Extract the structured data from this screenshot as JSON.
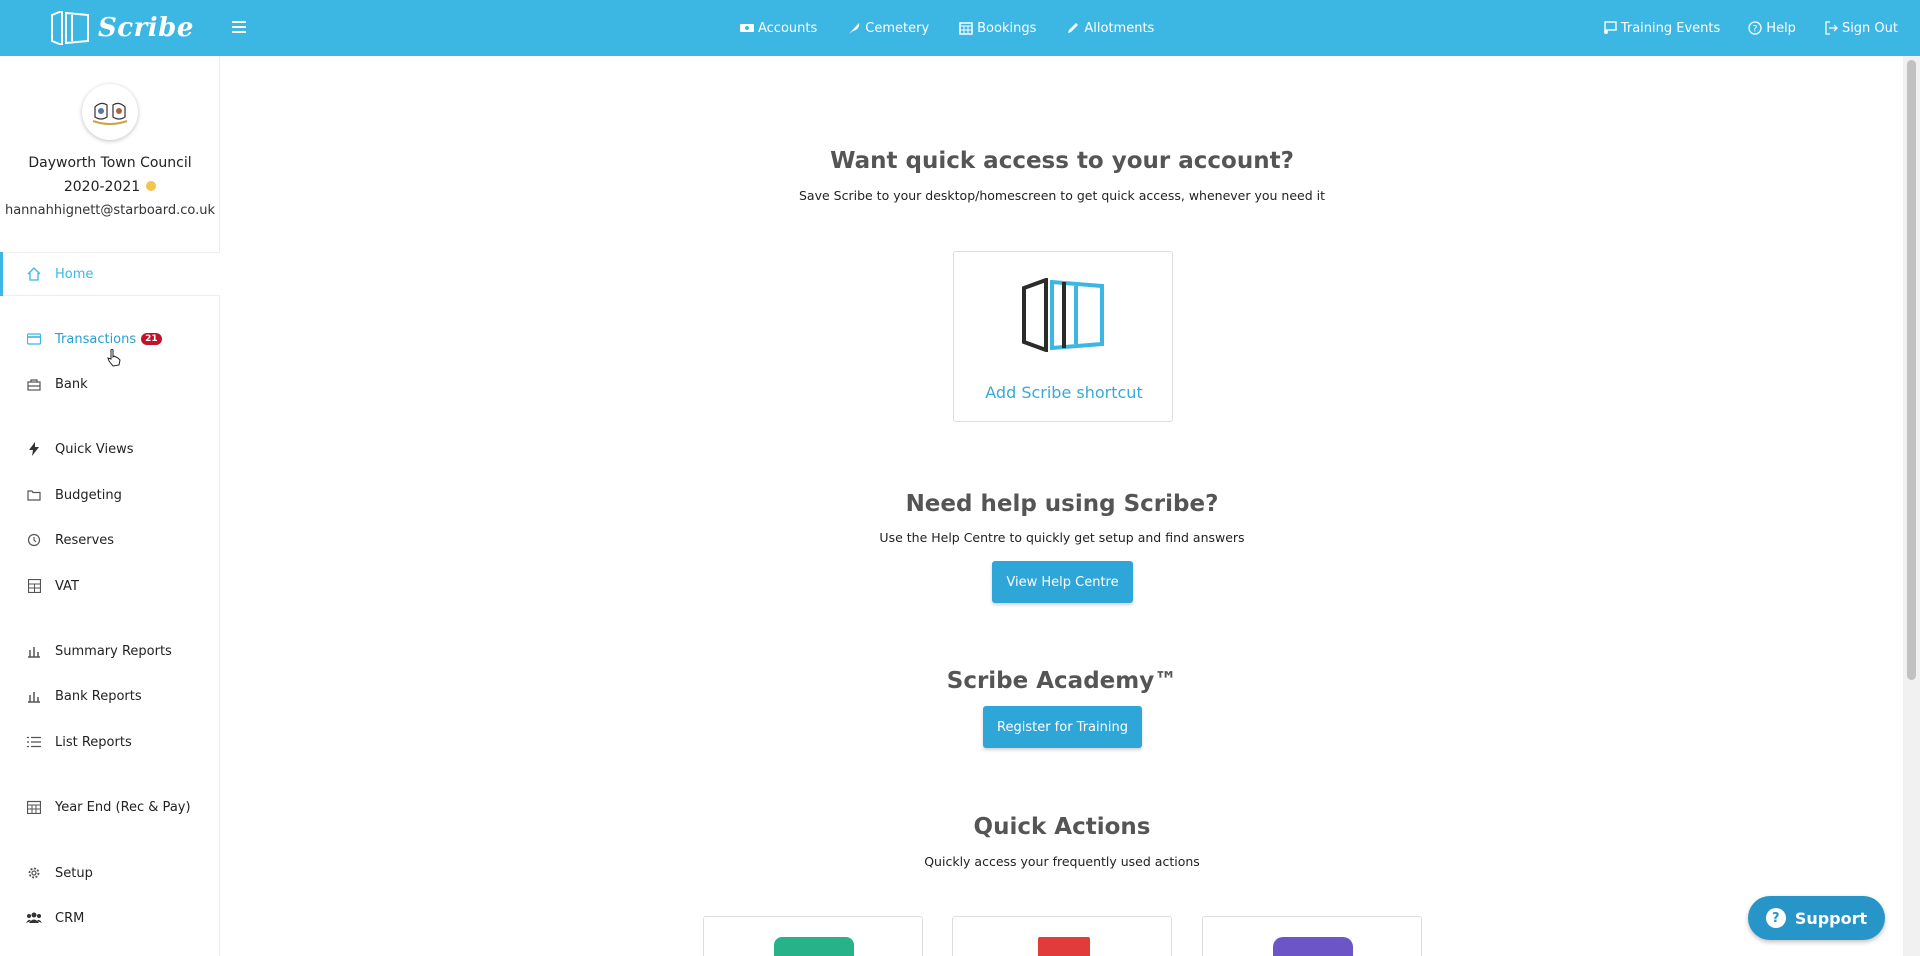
{
  "brand": {
    "name": "Scribe"
  },
  "topnav": [
    {
      "label": "Accounts",
      "icon": "money-icon"
    },
    {
      "label": "Cemetery",
      "icon": "feather-icon"
    },
    {
      "label": "Bookings",
      "icon": "calendar-icon"
    },
    {
      "label": "Allotments",
      "icon": "pencil-icon"
    }
  ],
  "topright": [
    {
      "label": "Training Events",
      "icon": "presentation-icon"
    },
    {
      "label": "Help",
      "icon": "question-circle-icon"
    },
    {
      "label": "Sign Out",
      "icon": "sign-out-icon"
    }
  ],
  "org": {
    "name": "Dayworth Town Council",
    "year": "2020-2021",
    "email": "hannahhignett@starboard.co.uk"
  },
  "sidebar": {
    "items": [
      {
        "label": "Home",
        "icon": "home-icon"
      },
      {
        "label": "Transactions",
        "icon": "credit-card-icon",
        "badge": "21"
      },
      {
        "label": "Bank",
        "icon": "bank-icon"
      },
      {
        "label": "Quick Views",
        "icon": "bolt-icon"
      },
      {
        "label": "Budgeting",
        "icon": "folder-icon"
      },
      {
        "label": "Reserves",
        "icon": "history-icon"
      },
      {
        "label": "VAT",
        "icon": "calculator-icon"
      },
      {
        "label": "Summary Reports",
        "icon": "bar-chart-icon"
      },
      {
        "label": "Bank Reports",
        "icon": "bar-chart-icon"
      },
      {
        "label": "List Reports",
        "icon": "list-icon"
      },
      {
        "label": "Year End (Rec & Pay)",
        "icon": "calendar-icon"
      },
      {
        "label": "Setup",
        "icon": "gear-icon"
      },
      {
        "label": "CRM",
        "icon": "users-icon"
      }
    ]
  },
  "main": {
    "quick_access": {
      "title": "Want quick access to your account?",
      "subtitle": "Save Scribe to your desktop/homescreen to get quick access, whenever you need it",
      "card_label": "Add Scribe shortcut"
    },
    "help": {
      "title": "Need help using Scribe?",
      "subtitle": "Use the Help Centre to quickly get setup and find answers",
      "button": "View Help Centre"
    },
    "academy": {
      "title": "Scribe Academy™",
      "button": "Register for Training"
    },
    "quick_actions": {
      "title": "Quick Actions",
      "subtitle": "Quickly access your frequently used actions"
    }
  },
  "support": {
    "label": "Support"
  },
  "colors": {
    "brand": "#3cb6e3",
    "button": "#2fa6d8",
    "badge": "#c0132a",
    "year_dot": "#f5c44a",
    "qa_green": "#27b28a",
    "qa_red": "#e23b3b",
    "qa_purple": "#6c55c7"
  }
}
